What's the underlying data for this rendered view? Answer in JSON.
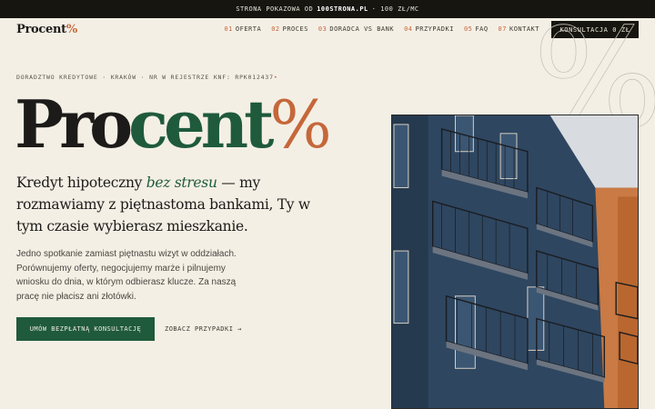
{
  "topbar": {
    "prefix": "STRONA POKAZOWA OD",
    "brand": "100STRONA.PL",
    "suffix": "· 100 ZŁ/MC"
  },
  "logo": {
    "text": "Procent",
    "mark": "%"
  },
  "nav": {
    "items": [
      {
        "num": "01",
        "label": "OFERTA"
      },
      {
        "num": "02",
        "label": "PROCES"
      },
      {
        "num": "03",
        "label": "DORADCA VS BANK"
      },
      {
        "num": "04",
        "label": "PRZYPADKI"
      },
      {
        "num": "05",
        "label": "FAQ"
      },
      {
        "num": "07",
        "label": "KONTAKT"
      }
    ],
    "cta": "KONSULTACJA 0 ZŁ"
  },
  "deco": {
    "glyph": "%"
  },
  "hero": {
    "eyebrow": "DORADZTWO KREDYTOWE · KRAKÓW · NR W REJESTRZE KNF: RPK012437",
    "eyebrow_dot": "•",
    "title_part1": "Pro",
    "title_part2": "cent",
    "title_part3": "%",
    "subhead_pre": "Kredyt hipoteczny",
    "subhead_em": "bez stresu",
    "subhead_post": "— my rozmawiamy z piętnastoma bankami, Ty w tym czasie wybierasz mieszkanie.",
    "body": "Jedno spotkanie zamiast piętnastu wizyt w oddziałach. Porównujemy oferty, negocjujemy marże i pilnujemy wniosku do dnia, w którym odbierasz klucze. Za naszą pracę nie płacisz ani złotówki.",
    "cta_primary": "UMÓW BEZPŁATNĄ KONSULTACJĘ",
    "cta_secondary": "ZOBACZ PRZYPADKI →"
  },
  "colors": {
    "accent": "#c5673a",
    "green": "#1f5a3d",
    "dark": "#16150f",
    "background": "#f4efe5"
  }
}
